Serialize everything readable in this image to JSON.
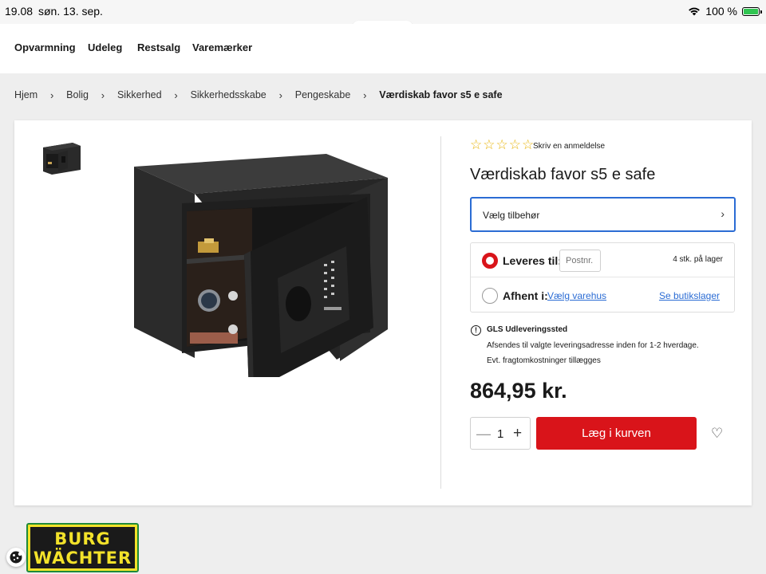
{
  "status_bar": {
    "time": "19.08",
    "date": "søn. 13. sep.",
    "battery": "100 %",
    "url": "bauhaus.dk"
  },
  "nav": {
    "items": [
      "Opvarmning",
      "Udeleg",
      "Restsalg",
      "Varemærker"
    ]
  },
  "breadcrumb": {
    "items": [
      "Hjem",
      "Bolig",
      "Sikkerhed",
      "Sikkerhedsskabe",
      "Pengeskabe",
      "Værdiskab favor s5 e safe"
    ]
  },
  "product": {
    "review_link": "Skriv en anmeldelse",
    "title": "Værdiskab favor s5 e safe",
    "accessory_label": "Vælg tilbehør",
    "delivery": {
      "deliver_label": "Leveres til:",
      "postal_placeholder": "Postnr.",
      "stock": "4 stk. på lager",
      "pickup_label": "Afhent i:",
      "choose_store": "Vælg varehus",
      "store_stock": "Se butikslager"
    },
    "gls": {
      "title": "GLS Udleveringssted",
      "line1": "Afsendes til valgte leveringsadresse inden for 1-2 hverdage.",
      "line2": "Evt. fragtomkostninger tillægges"
    },
    "price": "864,95 kr.",
    "quantity": "1",
    "add_to_cart": "Læg i kurven"
  },
  "brand": {
    "line1": "BURG",
    "line2": "WÄCHTER"
  },
  "colors": {
    "accent_red": "#d9141a",
    "link_blue": "#2b6cd4",
    "star_yellow": "#e8b40a"
  },
  "icons": {
    "wifi": "wifi-icon",
    "battery": "battery-icon",
    "chevron": "chevron-right-icon",
    "info": "info-icon",
    "heart": "heart-icon",
    "cookie": "cookie-icon"
  }
}
